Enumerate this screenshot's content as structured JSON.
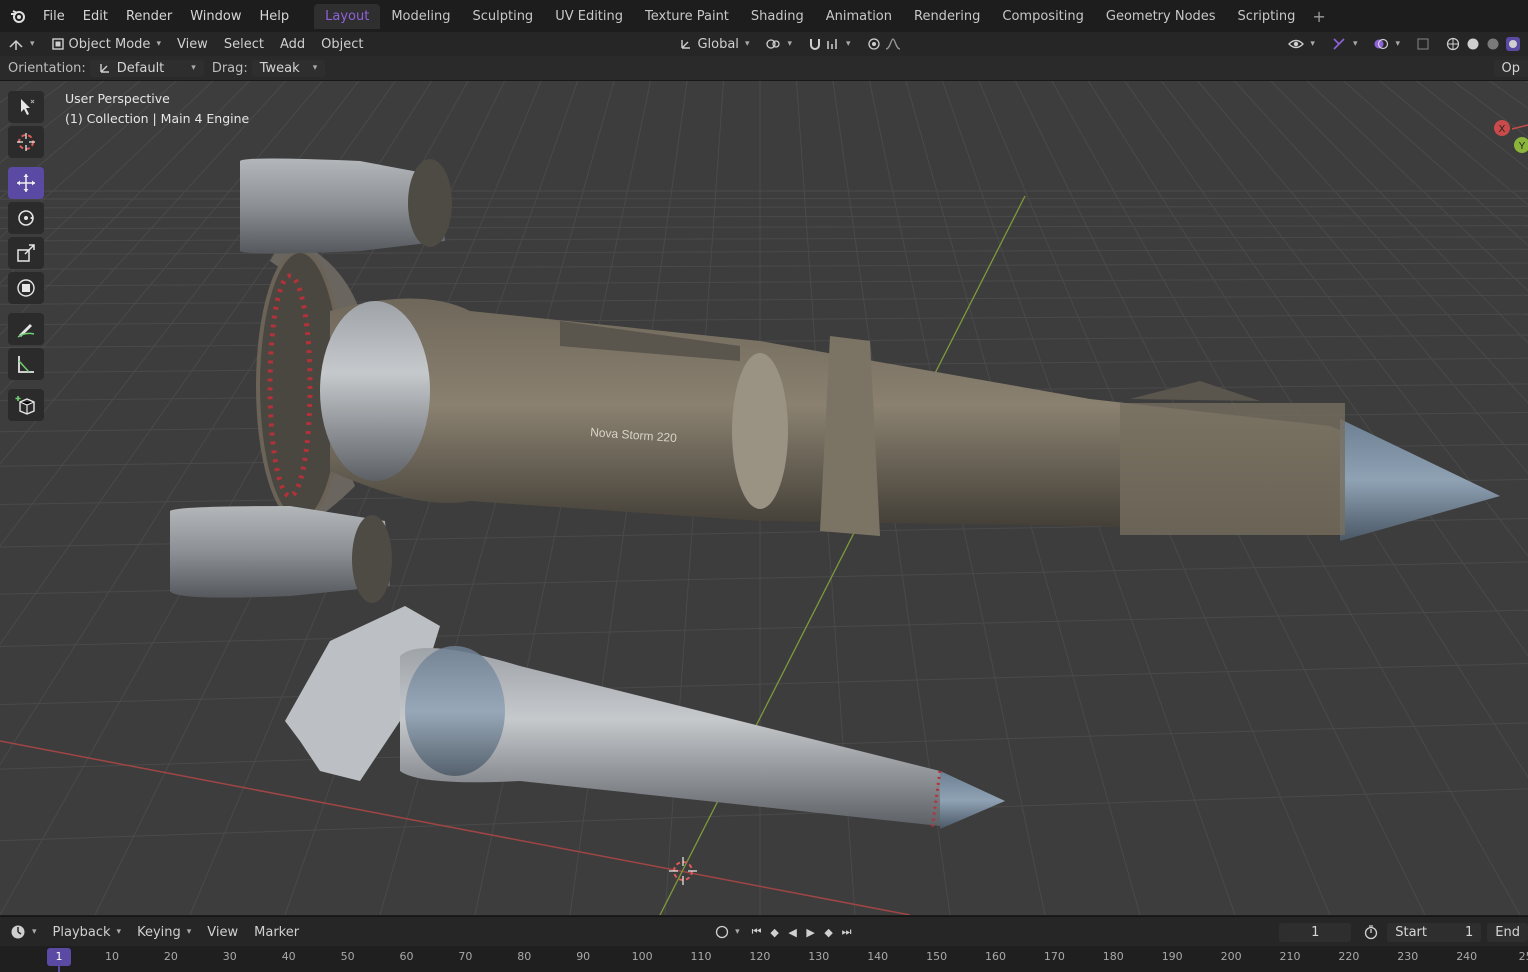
{
  "topbar": {
    "menus": [
      "File",
      "Edit",
      "Render",
      "Window",
      "Help"
    ],
    "workspaces": [
      "Layout",
      "Modeling",
      "Sculpting",
      "UV Editing",
      "Texture Paint",
      "Shading",
      "Animation",
      "Rendering",
      "Compositing",
      "Geometry Nodes",
      "Scripting"
    ],
    "active_workspace": "Layout",
    "add_label": "+"
  },
  "header": {
    "mode": "Object Mode",
    "menus": [
      "View",
      "Select",
      "Add",
      "Object"
    ],
    "transform_orientation": "Global"
  },
  "tool_options": {
    "orientation_label": "Orientation:",
    "orientation_value": "Default",
    "drag_label": "Drag:",
    "drag_value": "Tweak",
    "right_panel_label": "Op"
  },
  "viewport": {
    "view_name": "User Perspective",
    "collection_line": "(1) Collection | Main 4 Engine",
    "model_label": "Nova Storm 220",
    "gizmo_x_label": "X",
    "gizmo_y_label": "Y",
    "colors": {
      "background": "#3d3d3d",
      "grid": "#4a4a4a",
      "x_axis": "#a04545",
      "y_axis": "#7d9a3a",
      "accent": "#5b4aa3"
    }
  },
  "tools": [
    "select-box",
    "cursor",
    "move",
    "rotate",
    "scale",
    "transform",
    "annotate",
    "measure",
    "add-cube"
  ],
  "active_tool": "move",
  "timeline": {
    "menus": [
      "Playback",
      "Keying",
      "View",
      "Marker"
    ],
    "current_frame": "1",
    "start_label": "Start",
    "start_value": "1",
    "end_label": "End",
    "frame_marker": "1",
    "ticks": [
      "10",
      "20",
      "30",
      "40",
      "50",
      "60",
      "70",
      "80",
      "90",
      "100",
      "110",
      "120",
      "130",
      "140",
      "150",
      "160",
      "170",
      "180",
      "190",
      "200",
      "210",
      "220",
      "230",
      "240",
      "25"
    ]
  }
}
